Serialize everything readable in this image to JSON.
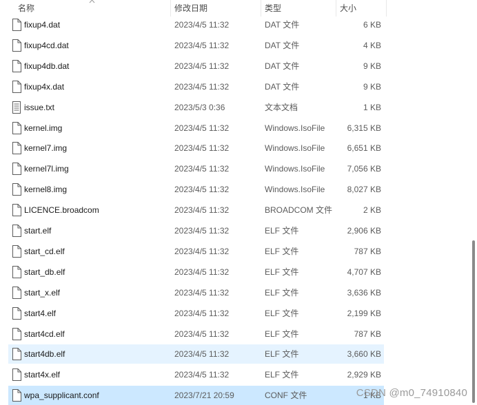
{
  "columns": {
    "name": "名称",
    "date": "修改日期",
    "type": "类型",
    "size": "大小"
  },
  "files": [
    {
      "name": "fixup4.dat",
      "date": "2023/4/5 11:32",
      "type": "DAT 文件",
      "size": "6 KB",
      "icon": "file-icon"
    },
    {
      "name": "fixup4cd.dat",
      "date": "2023/4/5 11:32",
      "type": "DAT 文件",
      "size": "4 KB",
      "icon": "file-icon"
    },
    {
      "name": "fixup4db.dat",
      "date": "2023/4/5 11:32",
      "type": "DAT 文件",
      "size": "9 KB",
      "icon": "file-icon"
    },
    {
      "name": "fixup4x.dat",
      "date": "2023/4/5 11:32",
      "type": "DAT 文件",
      "size": "9 KB",
      "icon": "file-icon"
    },
    {
      "name": "issue.txt",
      "date": "2023/5/3 0:36",
      "type": "文本文档",
      "size": "1 KB",
      "icon": "text-file-icon"
    },
    {
      "name": "kernel.img",
      "date": "2023/4/5 11:32",
      "type": "Windows.IsoFile",
      "size": "6,315 KB",
      "icon": "file-icon"
    },
    {
      "name": "kernel7.img",
      "date": "2023/4/5 11:32",
      "type": "Windows.IsoFile",
      "size": "6,651 KB",
      "icon": "file-icon"
    },
    {
      "name": "kernel7l.img",
      "date": "2023/4/5 11:32",
      "type": "Windows.IsoFile",
      "size": "7,056 KB",
      "icon": "file-icon"
    },
    {
      "name": "kernel8.img",
      "date": "2023/4/5 11:32",
      "type": "Windows.IsoFile",
      "size": "8,027 KB",
      "icon": "file-icon"
    },
    {
      "name": "LICENCE.broadcom",
      "date": "2023/4/5 11:32",
      "type": "BROADCOM 文件",
      "size": "2 KB",
      "icon": "file-icon"
    },
    {
      "name": "start.elf",
      "date": "2023/4/5 11:32",
      "type": "ELF 文件",
      "size": "2,906 KB",
      "icon": "file-icon"
    },
    {
      "name": "start_cd.elf",
      "date": "2023/4/5 11:32",
      "type": "ELF 文件",
      "size": "787 KB",
      "icon": "file-icon"
    },
    {
      "name": "start_db.elf",
      "date": "2023/4/5 11:32",
      "type": "ELF 文件",
      "size": "4,707 KB",
      "icon": "file-icon"
    },
    {
      "name": "start_x.elf",
      "date": "2023/4/5 11:32",
      "type": "ELF 文件",
      "size": "3,636 KB",
      "icon": "file-icon"
    },
    {
      "name": "start4.elf",
      "date": "2023/4/5 11:32",
      "type": "ELF 文件",
      "size": "2,199 KB",
      "icon": "file-icon"
    },
    {
      "name": "start4cd.elf",
      "date": "2023/4/5 11:32",
      "type": "ELF 文件",
      "size": "787 KB",
      "icon": "file-icon"
    },
    {
      "name": "start4db.elf",
      "date": "2023/4/5 11:32",
      "type": "ELF 文件",
      "size": "3,660 KB",
      "icon": "file-icon",
      "state": "hover"
    },
    {
      "name": "start4x.elf",
      "date": "2023/4/5 11:32",
      "type": "ELF 文件",
      "size": "2,929 KB",
      "icon": "file-icon"
    },
    {
      "name": "wpa_supplicant.conf",
      "date": "2023/7/21 20:59",
      "type": "CONF 文件",
      "size": "1 KB",
      "icon": "file-icon",
      "state": "selected"
    }
  ],
  "watermark": "CSDN @m0_74910840",
  "colors": {
    "hover_row": "#e5f3ff",
    "selected_row": "#cce8ff"
  }
}
